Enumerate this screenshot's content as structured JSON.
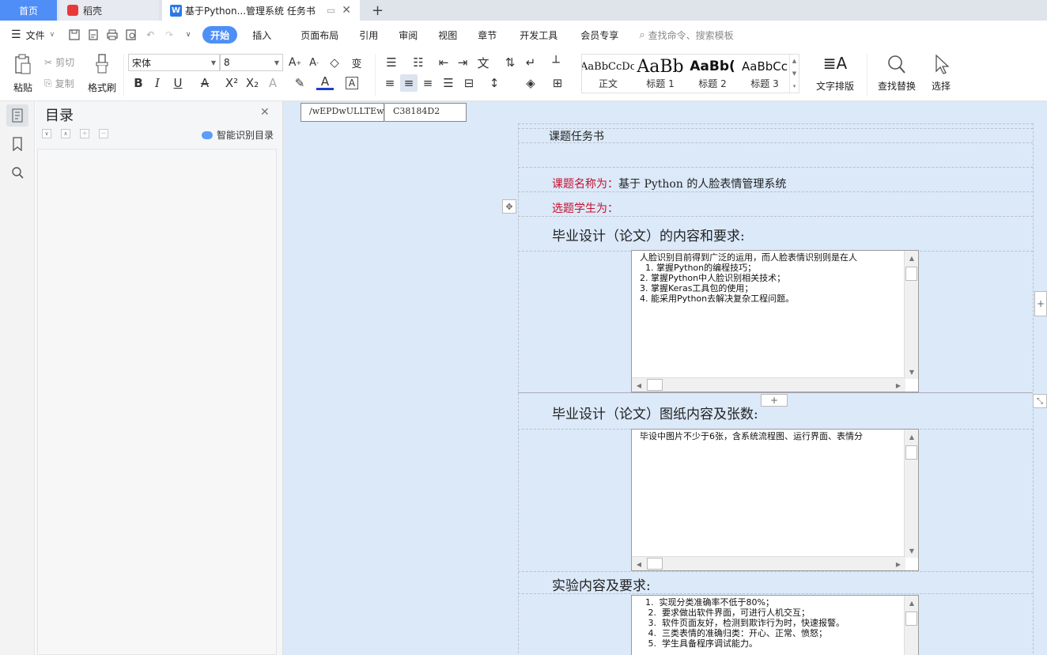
{
  "tabs": {
    "home": "首页",
    "daoke": "稻壳",
    "doc": "基于Python...管理系统 任务书",
    "add": "+"
  },
  "menu": {
    "file": "文件",
    "items": [
      "开始",
      "插入",
      "页面布局",
      "引用",
      "审阅",
      "视图",
      "章节",
      "开发工具",
      "会员专享"
    ],
    "search": "查找命令、搜索模板"
  },
  "ribbon": {
    "paste": "粘贴",
    "cut": "剪切",
    "copy": "复制",
    "format_painter": "格式刷",
    "font_name": "宋体",
    "font_size": "8",
    "styles": [
      {
        "sample": "AaBbCcDc",
        "label": "正文"
      },
      {
        "sample": "AaBb",
        "label": "标题 1"
      },
      {
        "sample": "AaBb(",
        "label": "标题 2"
      },
      {
        "sample": "AaBbCc",
        "label": "标题 3"
      }
    ],
    "text_layout": "文字排版",
    "find_replace": "查找替换",
    "select": "选择"
  },
  "toc": {
    "title": "目录",
    "smart": "智能识别目录"
  },
  "doc": {
    "field1": "/wEPDwULLTEwMD",
    "field2": "C38184D2",
    "heading": "课题任务书",
    "topic_label": "课题名称为：",
    "topic_value": "基于 Python 的人脸表情管理系统",
    "student_label": "选题学生为：",
    "section1": "毕业设计（论文）的内容和要求:",
    "box1": "人脸识别目前得到广泛的运用，而人脸表情识别则是在人\n  1. 掌握Python的编程技巧；\n2. 掌握Python中人脸识别相关技术；\n3. 掌握Keras工具包的使用；\n4. 能采用Python去解决复杂工程问题。",
    "section2": "毕业设计（论文）图纸内容及张数:",
    "box2": "毕设中图片不少于6张，含系统流程图、运行界面、表情分",
    "section3": "实验内容及要求:",
    "box3": "  1.  实现分类准确率不低于80%；\n   2.  要求做出软件界面，可进行人机交互；\n   3.  软件页面友好，检测到欺诈行为时，快速报警。\n   4.  三类表情的准确归类：开心、正常、愤怒；\n   5.  学生具备程序调试能力。"
  },
  "colors": {
    "accent": "#4e8ff7",
    "label_red": "#c8102e",
    "doc_bg": "#dbe9f9"
  }
}
